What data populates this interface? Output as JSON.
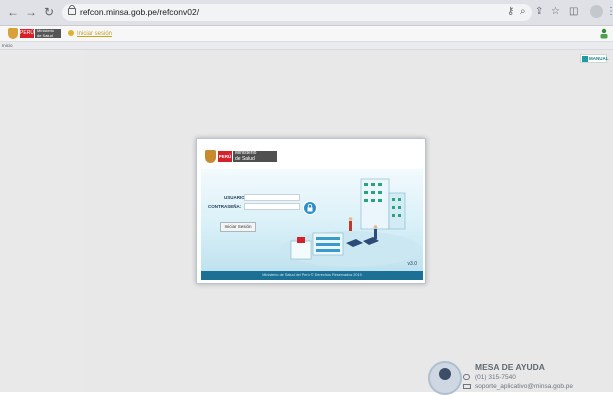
{
  "browser": {
    "url": "refcon.minsa.gob.pe/refconv02/",
    "icons": [
      "back-icon",
      "forward-icon",
      "reload-icon",
      "lock-icon",
      "key-icon",
      "zoom-icon",
      "share-icon",
      "star-icon",
      "sidepanel-icon",
      "profile-icon",
      "menu-icon"
    ]
  },
  "app_header": {
    "peru": "PERÚ",
    "ministry_line1": "Ministerio",
    "ministry_line2": "de Salud",
    "link": "Iniciar sesión"
  },
  "strip": {
    "label": "Inicio"
  },
  "manual": {
    "label": "MANUAL"
  },
  "login": {
    "peru": "PERÚ",
    "ministry_line1": "Ministerio",
    "ministry_line2": "de Salud",
    "user_label": "USUARIO:",
    "user_value": "",
    "password_label": "CONTRASEÑA:",
    "password_value": "",
    "signin_label": "Iniciar Sesión",
    "version": "v3.0",
    "footer": "Ministerio de Salud del Perú © Derechos Reservados 2019"
  },
  "help": {
    "title": "MESA DE AYUDA",
    "phone": "(01) 315-7540",
    "email": "soporte_aplicativo@minsa.gob.pe"
  },
  "colors": {
    "accent": "#1c6f95",
    "peru_red": "#d6202a"
  }
}
